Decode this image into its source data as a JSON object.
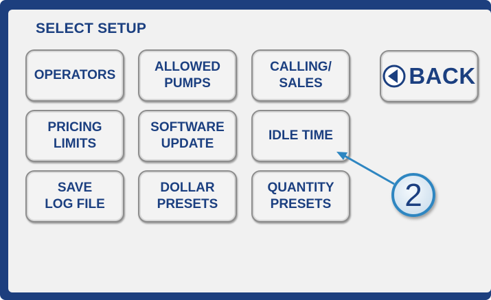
{
  "screen": {
    "title": "SELECT SETUP"
  },
  "buttons": {
    "operators": "OPERATORS",
    "allowed_pumps": "ALLOWED\nPUMPS",
    "calling_sales": "CALLING/\nSALES",
    "back": "BACK",
    "pricing_limits": "PRICING\nLIMITS",
    "software_update": "SOFTWARE\nUPDATE",
    "idle_time": "IDLE TIME",
    "save_log_file": "SAVE\nLOG FILE",
    "dollar_presets": "DOLLAR\nPRESETS",
    "quantity_presets": "QUANTITY\nPRESETS"
  },
  "icons": {
    "back": "left-arrow-circle-icon"
  },
  "callout": {
    "number": "2",
    "color": "#2e86c1"
  },
  "colors": {
    "frame": "#1d3f7e",
    "panel": "#f1f1f1",
    "text": "#1b3f80"
  }
}
